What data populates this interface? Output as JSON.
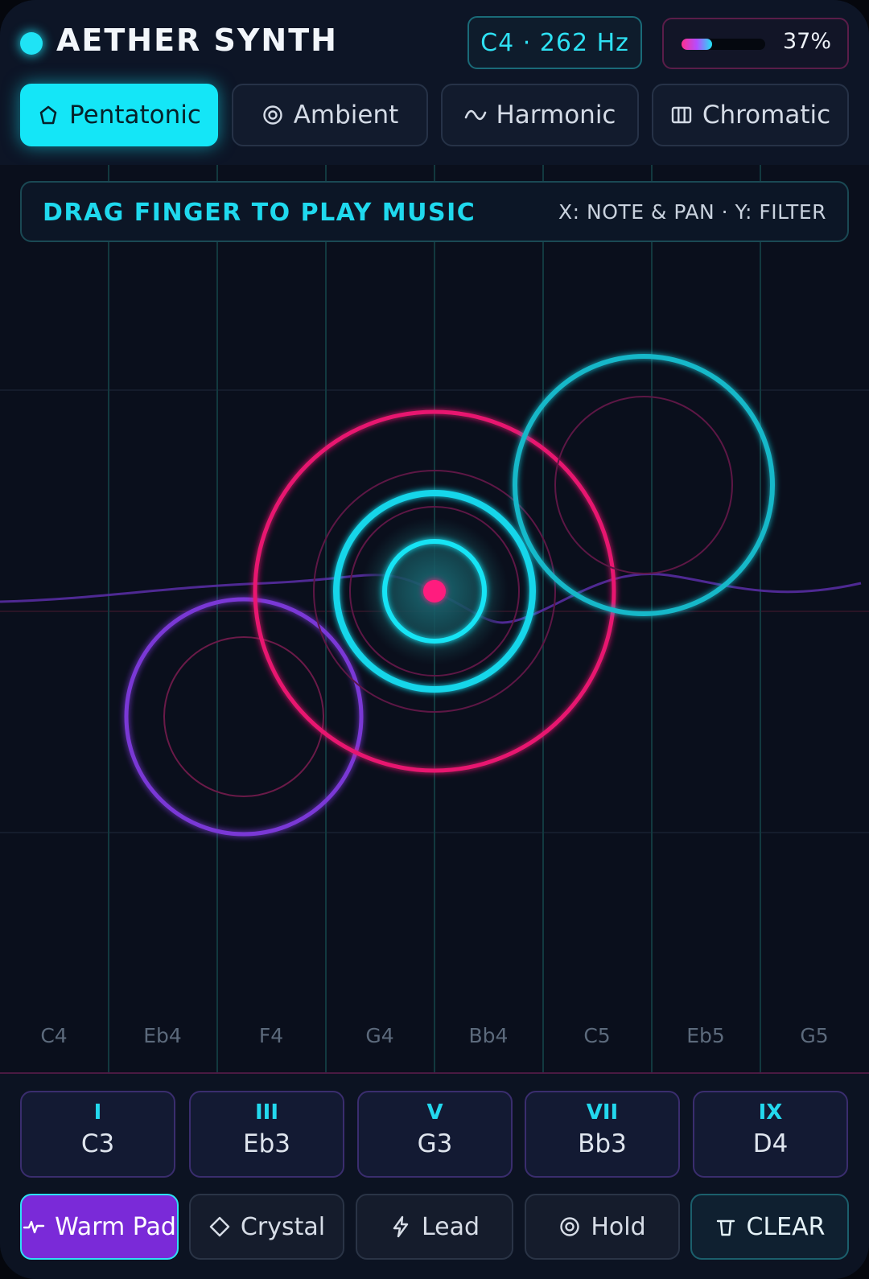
{
  "header": {
    "title": "AETHER SYNTH",
    "current_note": "C4 · 262 Hz",
    "volume_percent": 37,
    "volume_label": "37%"
  },
  "modes": [
    {
      "label": "Pentatonic",
      "icon": "pentagon-icon",
      "active": true
    },
    {
      "label": "Ambient",
      "icon": "target-icon",
      "active": false
    },
    {
      "label": "Harmonic",
      "icon": "wave-icon",
      "active": false
    },
    {
      "label": "Chromatic",
      "icon": "piano-keys-icon",
      "active": false
    }
  ],
  "hint": {
    "main": "DRAG FINGER TO PLAY MUSIC",
    "sub": "X: NOTE & PAN · Y: FILTER"
  },
  "note_axis": [
    "C4",
    "Eb4",
    "F4",
    "G4",
    "Bb4",
    "C5",
    "Eb5",
    "G5"
  ],
  "chords": [
    {
      "roman": "I",
      "note": "C3"
    },
    {
      "roman": "III",
      "note": "Eb3"
    },
    {
      "roman": "V",
      "note": "G3"
    },
    {
      "roman": "VII",
      "note": "Bb3"
    },
    {
      "roman": "IX",
      "note": "D4"
    }
  ],
  "sounds": [
    {
      "label": "Warm Pad",
      "icon": "pulse-icon",
      "active": true
    },
    {
      "label": "Crystal",
      "icon": "diamond-icon",
      "active": false
    },
    {
      "label": "Lead",
      "icon": "bolt-icon",
      "active": false
    },
    {
      "label": "Hold",
      "icon": "target-icon",
      "active": false
    },
    {
      "label": "CLEAR",
      "icon": "trash-icon",
      "active": false
    }
  ],
  "colors": {
    "accent_cyan": "#14e6f7",
    "accent_magenta": "#ff2f8f",
    "accent_purple": "#7a2ad8"
  }
}
